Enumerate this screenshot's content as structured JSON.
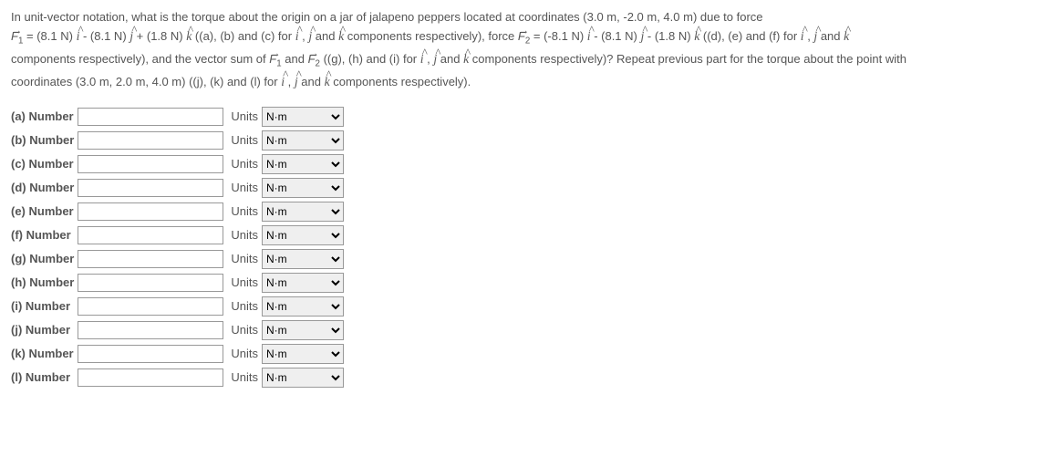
{
  "question": {
    "line1_pre": "In unit-vector notation, what is the torque about the origin on a jar of jalapeno peppers located at coordinates (3.0 m, -2.0 m, 4.0 m) due to force",
    "F1": "F",
    "F1_sub": "1",
    "eq1": " = (8.1 N) ",
    "i": "i",
    "minus": " - (8.1 N) ",
    "j": "j",
    "plus": " + (1.8 N) ",
    "k": "k",
    "par1": " ((a), (b) and (c) for ",
    "comma": " , ",
    "and": " and ",
    "comp_resp": " components respectively), force ",
    "F2": "F",
    "F2_sub": "2",
    "eq2": " = (-8.1 N) ",
    "minus2": " - (8.1 N) ",
    "minus3": " - (1.8 N) ",
    "par2": " ((d), (e) and (f) for ",
    "line3_a": "components respectively), and the vector sum of ",
    "F1b": "F",
    "F2b": "F",
    "par3": " ((g), (h) and (i) for ",
    "comp_resp2": " components respectively)? Repeat previous part for the torque about the point with",
    "line4": "coordinates (3.0 m, 2.0 m, 4.0 m) ((j), (k) and (l) for ",
    "comp_resp3": " components respectively)."
  },
  "rows": [
    {
      "label": "(a) Number",
      "units": "Units",
      "selected": "N·m"
    },
    {
      "label": "(b) Number",
      "units": "Units",
      "selected": "N·m"
    },
    {
      "label": "(c) Number",
      "units": "Units",
      "selected": "N·m"
    },
    {
      "label": "(d) Number",
      "units": "Units",
      "selected": "N·m"
    },
    {
      "label": "(e) Number",
      "units": "Units",
      "selected": "N·m"
    },
    {
      "label": "(f) Number",
      "units": "Units",
      "selected": "N·m"
    },
    {
      "label": "(g) Number",
      "units": "Units",
      "selected": "N·m"
    },
    {
      "label": "(h) Number",
      "units": "Units",
      "selected": "N·m"
    },
    {
      "label": "(i) Number",
      "units": "Units",
      "selected": "N·m"
    },
    {
      "label": "(j) Number",
      "units": "Units",
      "selected": "N·m"
    },
    {
      "label": "(k) Number",
      "units": "Units",
      "selected": "N·m"
    },
    {
      "label": "(l) Number",
      "units": "Units",
      "selected": "N·m"
    }
  ]
}
